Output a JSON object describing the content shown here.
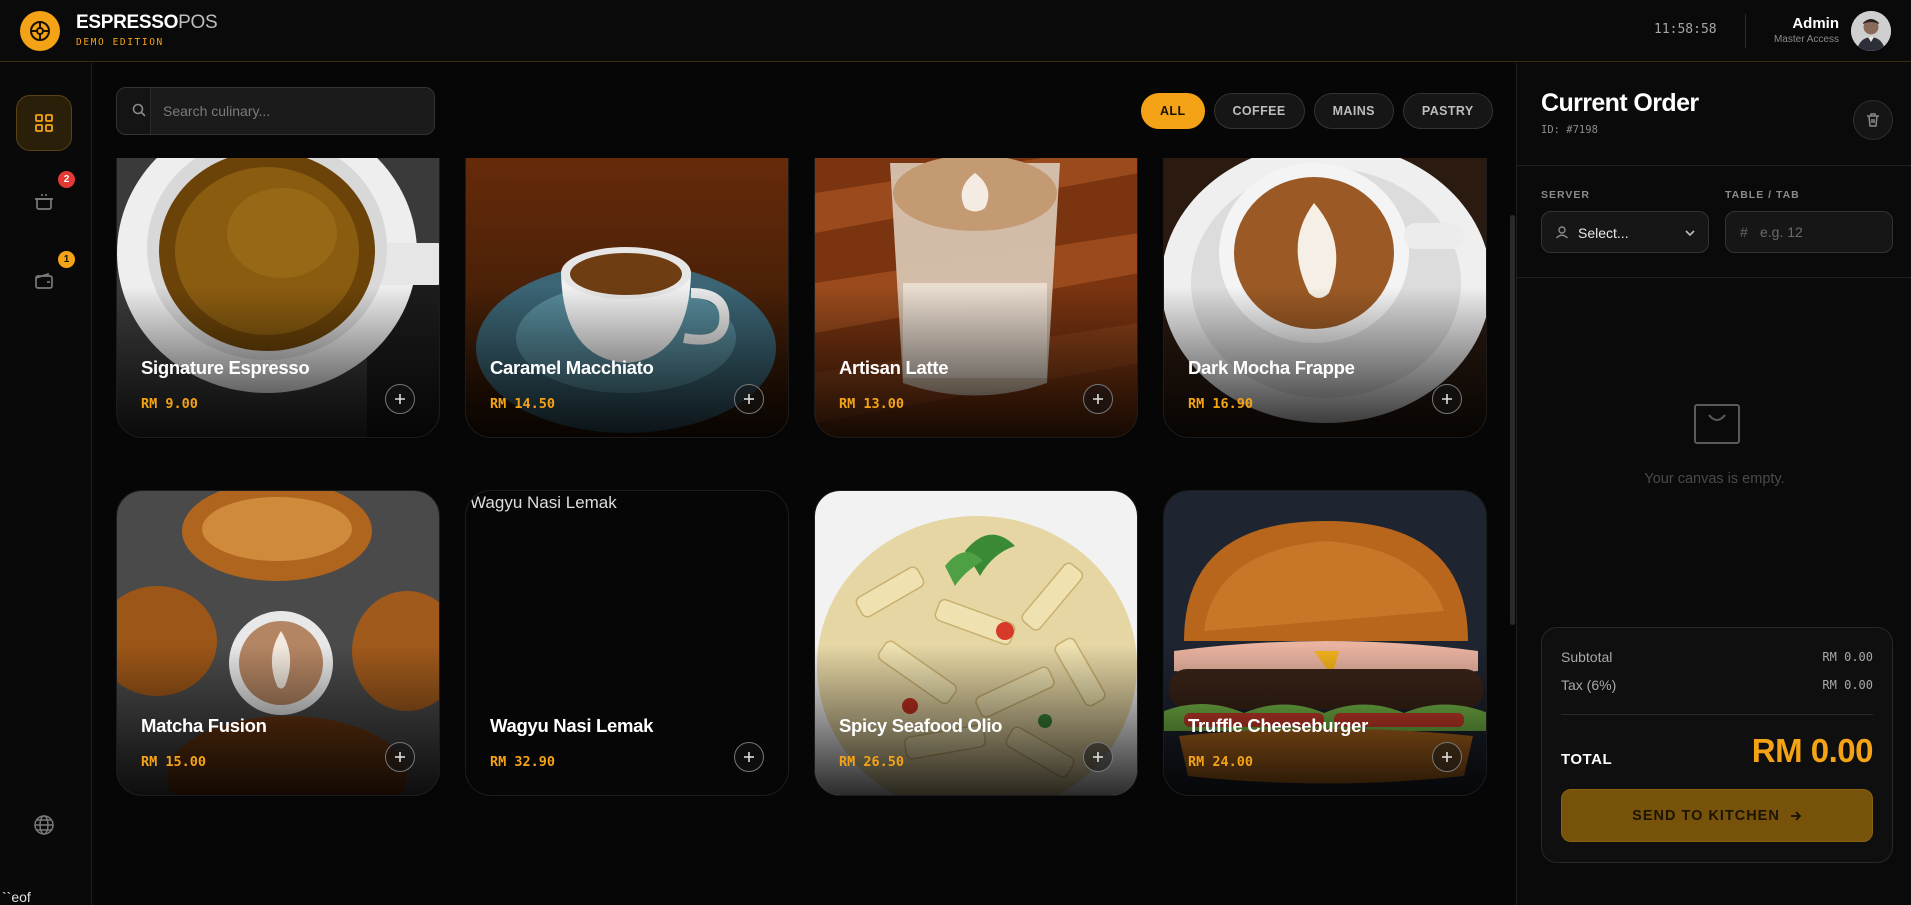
{
  "header": {
    "brand_bold": "ESPRESSO",
    "brand_light": "POS",
    "edition": "DEMO EDITION",
    "clock": "11:58:58",
    "user_name": "Admin",
    "user_role": "Master Access"
  },
  "rail": {
    "items": [
      {
        "icon": "grid-icon",
        "active": true
      },
      {
        "icon": "cooking-pot-icon",
        "badge": "2",
        "badge_color": "#e53935"
      },
      {
        "icon": "wallet-icon",
        "badge": "1",
        "badge_color": "#f5a316"
      },
      {
        "icon": "globe-icon"
      }
    ]
  },
  "search": {
    "placeholder": "Search culinary..."
  },
  "categories": [
    "ALL",
    "COFFEE",
    "MAINS",
    "PASTRY"
  ],
  "active_category": "ALL",
  "menu": [
    {
      "name": "Signature Espresso",
      "price": "RM 9.00"
    },
    {
      "name": "Caramel Macchiato",
      "price": "RM 14.50"
    },
    {
      "name": "Artisan Latte",
      "price": "RM 13.00"
    },
    {
      "name": "Dark Mocha Frappe",
      "price": "RM 16.90"
    },
    {
      "name": "Matcha Fusion",
      "price": "RM 15.00"
    },
    {
      "name": "Wagyu Nasi Lemak",
      "price": "RM 32.90",
      "image_alt": "Wagyu Nasi Lemak"
    },
    {
      "name": "Spicy Seafood Olio",
      "price": "RM 26.50"
    },
    {
      "name": "Truffle Cheeseburger",
      "price": "RM 24.00"
    }
  ],
  "order": {
    "title": "Current Order",
    "id": "ID: #7198",
    "server_label": "SERVER",
    "server_value": "Select...",
    "table_label": "TABLE / TAB",
    "table_placeholder": "e.g. 12",
    "empty_text": "Your canvas is empty.",
    "subtotal_label": "Subtotal",
    "subtotal_value": "RM 0.00",
    "tax_label": "Tax (6%)",
    "tax_value": "RM 0.00",
    "total_label": "TOTAL",
    "total_value": "RM 0.00",
    "send_label": "SEND TO KITCHEN"
  },
  "colors": {
    "accent": "#f5a316",
    "background": "#060606"
  },
  "footer_stray": "``eof"
}
